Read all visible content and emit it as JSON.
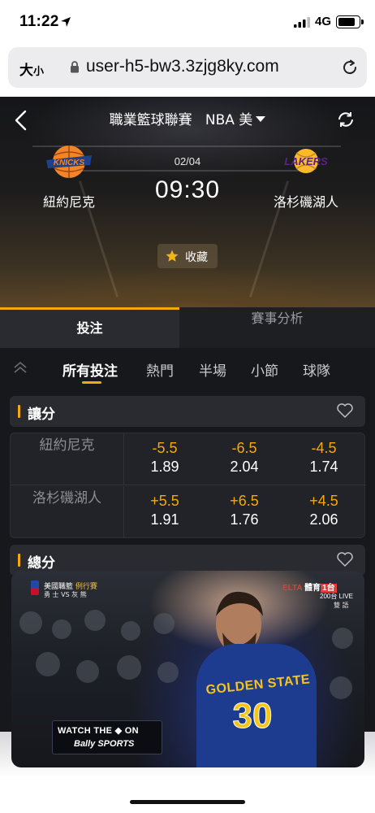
{
  "status_bar": {
    "time": "11:22",
    "network": "4G",
    "battery_level": 0.85
  },
  "browser": {
    "text_size_label": "大",
    "text_size_small": "小",
    "url": "user-h5-bw3.3zjg8ky.com"
  },
  "header": {
    "league_title": "職業籃球聯賽",
    "region": "NBA 美",
    "date": "02/04",
    "time": "09:30",
    "home_team": "紐約尼克",
    "away_team": "洛杉磯湖人",
    "favorite_label": "收藏",
    "home_logo_text": "KNICKS",
    "away_logo_text": "LAKERS"
  },
  "tabs": {
    "active": "投注",
    "inactive": "賽事分析"
  },
  "subnav": {
    "items": [
      "所有投注",
      "熱門",
      "半場",
      "小節",
      "球隊"
    ]
  },
  "sections": {
    "handicap_title": "讓分",
    "total_title": "總分"
  },
  "odds": {
    "rows": [
      {
        "team": "紐約尼克",
        "lines": [
          {
            "handicap": "-5.5",
            "price": "1.89"
          },
          {
            "handicap": "-6.5",
            "price": "2.04"
          },
          {
            "handicap": "-4.5",
            "price": "1.74"
          }
        ]
      },
      {
        "team": "洛杉磯湖人",
        "lines": [
          {
            "handicap": "+5.5",
            "price": "1.91"
          },
          {
            "handicap": "+6.5",
            "price": "1.76"
          },
          {
            "handicap": "+4.5",
            "price": "2.06"
          }
        ]
      }
    ]
  },
  "video": {
    "league_tag": "美國職籃",
    "season_tag": "例行賽",
    "matchup": "勇 士 VS 灰 熊",
    "channel_name": "ELTA",
    "channel_type": "體育",
    "channel_num": "1台",
    "live_label": "200台 LIVE",
    "lang_label": "雙 語",
    "jersey_text": "GOLDEN STATE",
    "jersey_number": "30",
    "banner_line1": "WATCH THE",
    "banner_on": "ON",
    "banner_line2": "Bally SPORTS"
  },
  "colors": {
    "accent": "#f3a90e",
    "dark_bg": "#17181b",
    "panel": "#222328"
  }
}
